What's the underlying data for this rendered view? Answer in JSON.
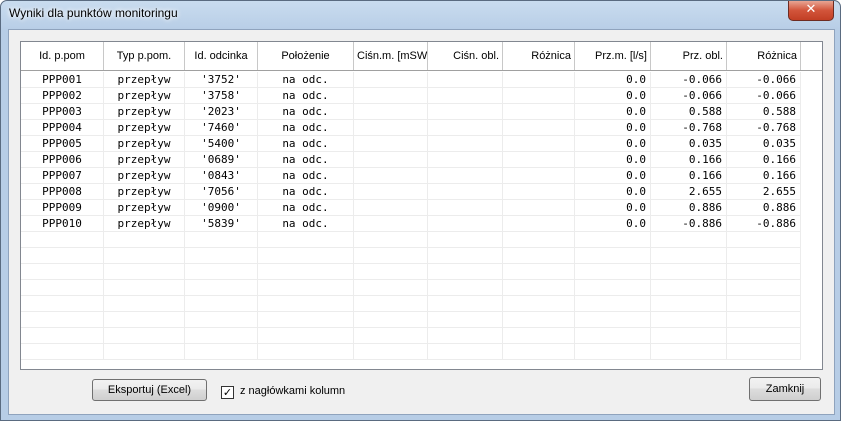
{
  "window": {
    "title": "Wyniki dla punktów monitoringu",
    "close_label": "✕"
  },
  "table": {
    "columns": [
      {
        "label": "Id. p.pom",
        "align": "c"
      },
      {
        "label": "Typ p.pom.",
        "align": "c"
      },
      {
        "label": "Id. odcinka",
        "align": "c"
      },
      {
        "label": "Położenie",
        "align": "c"
      },
      {
        "label": "Ciśn.m. [mSW]",
        "align": "c"
      },
      {
        "label": "Ciśn. obl.",
        "align": "r"
      },
      {
        "label": "Różnica",
        "align": "r"
      },
      {
        "label": "Prz.m. [l/s]",
        "align": "r"
      },
      {
        "label": "Prz. obl.",
        "align": "r"
      },
      {
        "label": "Różnica",
        "align": "r"
      }
    ],
    "rows": [
      [
        "PPP001",
        "przepływ",
        "'3752'",
        "na odc.",
        "",
        "",
        "",
        "0.0",
        "-0.066",
        "-0.066"
      ],
      [
        "PPP002",
        "przepływ",
        "'3758'",
        "na odc.",
        "",
        "",
        "",
        "0.0",
        "-0.066",
        "-0.066"
      ],
      [
        "PPP003",
        "przepływ",
        "'2023'",
        "na odc.",
        "",
        "",
        "",
        "0.0",
        "0.588",
        "0.588"
      ],
      [
        "PPP004",
        "przepływ",
        "'7460'",
        "na odc.",
        "",
        "",
        "",
        "0.0",
        "-0.768",
        "-0.768"
      ],
      [
        "PPP005",
        "przepływ",
        "'5400'",
        "na odc.",
        "",
        "",
        "",
        "0.0",
        "0.035",
        "0.035"
      ],
      [
        "PPP006",
        "przepływ",
        "'0689'",
        "na odc.",
        "",
        "",
        "",
        "0.0",
        "0.166",
        "0.166"
      ],
      [
        "PPP007",
        "przepływ",
        "'0843'",
        "na odc.",
        "",
        "",
        "",
        "0.0",
        "0.166",
        "0.166"
      ],
      [
        "PPP008",
        "przepływ",
        "'7056'",
        "na odc.",
        "",
        "",
        "",
        "0.0",
        "2.655",
        "2.655"
      ],
      [
        "PPP009",
        "przepływ",
        "'0900'",
        "na odc.",
        "",
        "",
        "",
        "0.0",
        "0.886",
        "0.886"
      ],
      [
        "PPP010",
        "przepływ",
        "'5839'",
        "na odc.",
        "",
        "",
        "",
        "0.0",
        "-0.886",
        "-0.886"
      ]
    ]
  },
  "footer": {
    "export_label": "Eksportuj (Excel)",
    "headers_checkbox_label": "z nagłówkami kolumn",
    "headers_checkbox_checked": true,
    "close_label": "Zamknij"
  }
}
